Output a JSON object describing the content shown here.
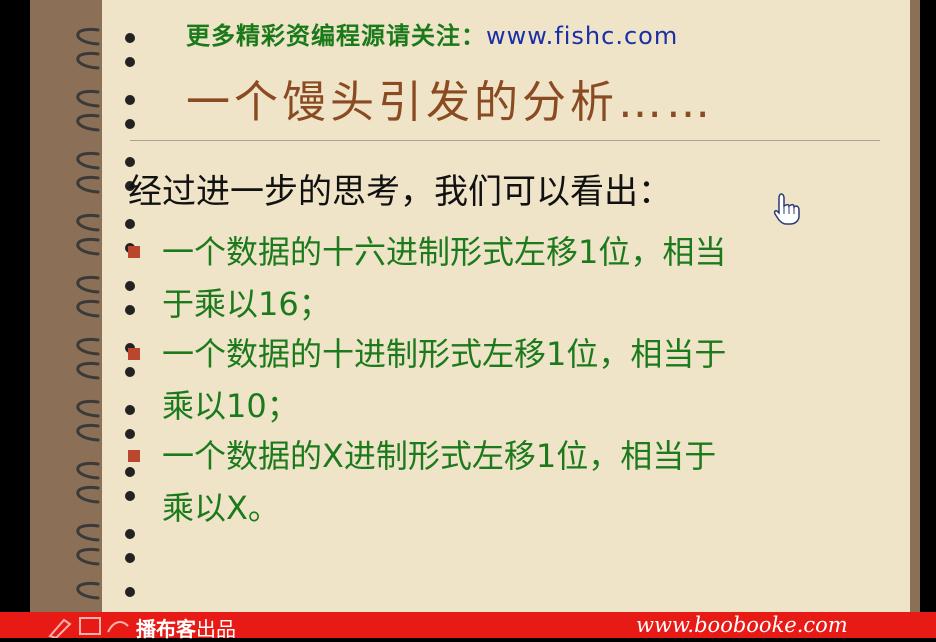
{
  "slide": {
    "top_note_prefix": "更多精彩资编程源请关注：",
    "top_note_url": "www.fishc.com",
    "title": "一个馒头引发的分析……",
    "lead": "经过进一步的思考，我们可以看出：",
    "bullets": [
      {
        "line1": "一个数据的十六进制形式左移1位，相当",
        "line2": "于乘以16；"
      },
      {
        "line1": "一个数据的十进制形式左移1位，相当于",
        "line2": "乘以10；"
      },
      {
        "line1": "一个数据的X进制形式左移1位，相当于",
        "line2": "乘以X。"
      }
    ]
  },
  "footer": {
    "brand": "播布客",
    "brand_suffix": "出品",
    "site": "www.boobooke.com"
  },
  "colors": {
    "board": "#8b6f57",
    "paper": "#efe4c8",
    "title": "#8a4a22",
    "bullet_text": "#1c7a1c",
    "url": "#1b2fa6",
    "footer": "#e81a16"
  },
  "icons": [
    "spiral-binding",
    "hand-pointer-cursor",
    "pencil-logo"
  ]
}
